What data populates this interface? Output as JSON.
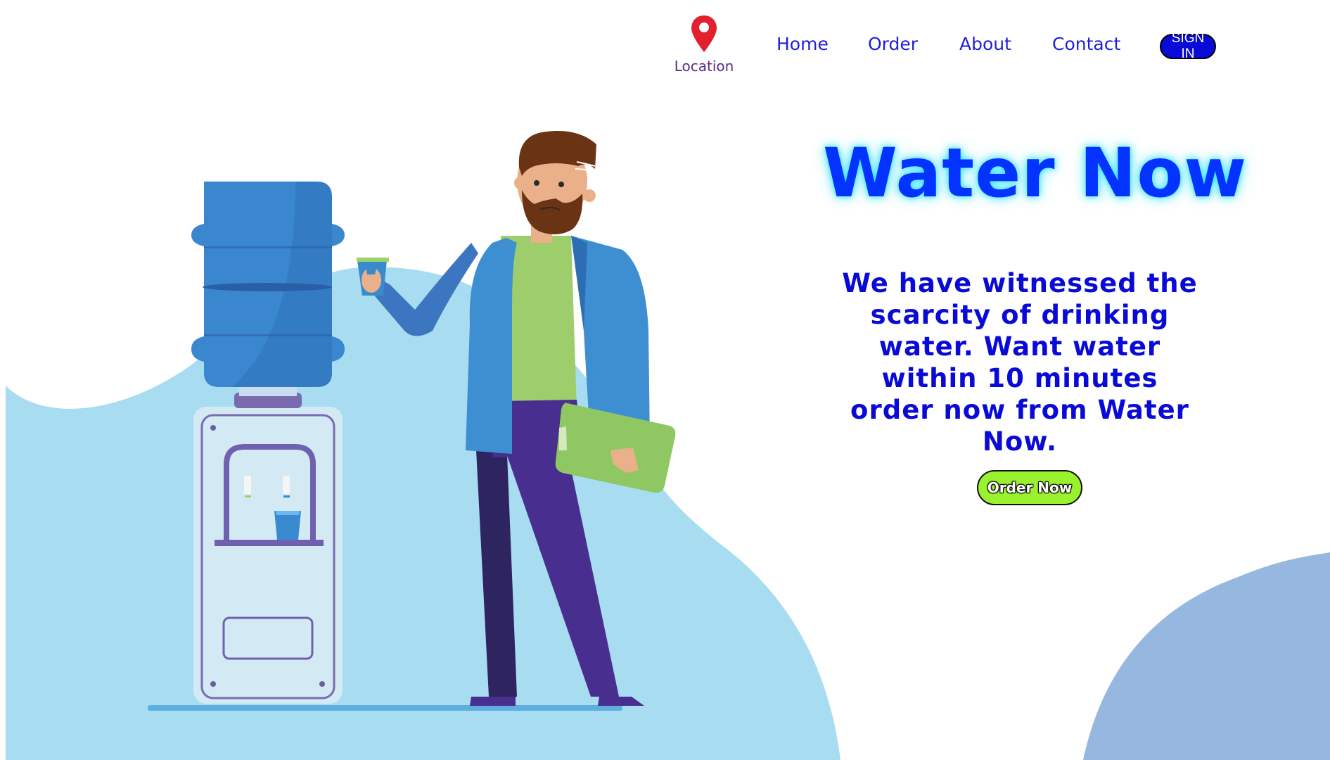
{
  "nav": {
    "location_icon": "map-pin-icon",
    "location_label": "Location",
    "links": [
      "Home",
      "Order",
      "About",
      "Contact"
    ],
    "signin_label": "SIGN IN"
  },
  "hero": {
    "title": "Water Now",
    "description": "We have witnessed the scarcity of drinking water. Want water within 10 minutes order now from Water Now.",
    "cta_label": "Order Now"
  },
  "colors": {
    "primary_blue": "#0433ff",
    "text_blue": "#0a0ad6",
    "cta_green": "#9af22e",
    "blob_light": "#a8dcf0",
    "blob_dark": "#96b7e0"
  }
}
